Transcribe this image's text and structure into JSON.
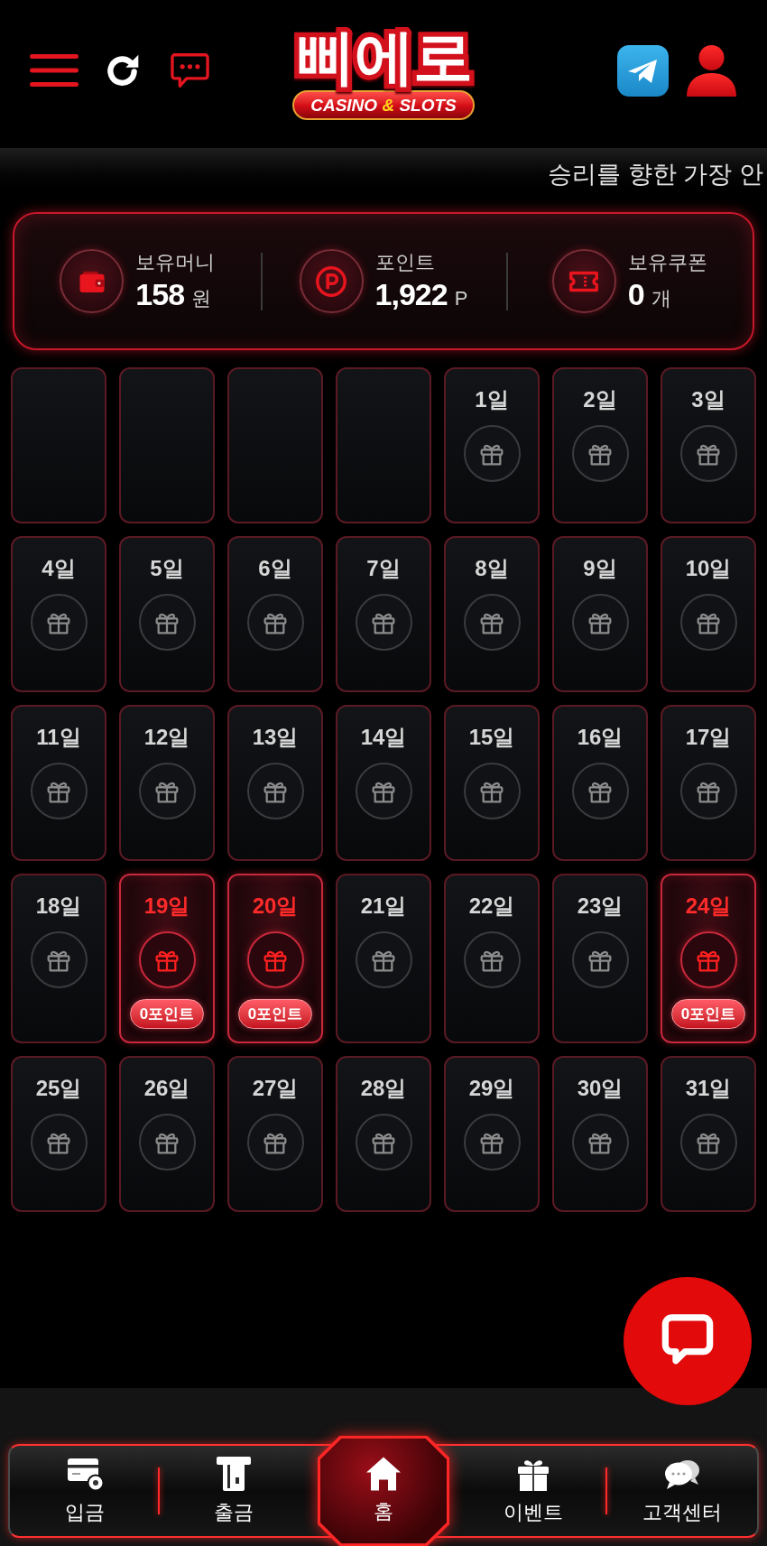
{
  "header": {
    "logo": {
      "title": "삐에로",
      "tagline": [
        {
          "kind": "word",
          "text": "CASINO"
        },
        {
          "kind": "accent",
          "text": "&"
        },
        {
          "kind": "word",
          "text": "SLOTS"
        }
      ]
    }
  },
  "marquee": {
    "text": "승리를 향한 가장 안"
  },
  "summary": [
    {
      "kind": "money",
      "label": "보유머니",
      "value": "158",
      "unit": "원"
    },
    {
      "kind": "points",
      "label": "포인트",
      "value": "1,922",
      "unit": "P"
    },
    {
      "kind": "coupons",
      "label": "보유쿠폰",
      "value": "0",
      "unit": "개"
    }
  ],
  "calendar": {
    "cells": [
      {
        "kind": "empty"
      },
      {
        "kind": "empty"
      },
      {
        "kind": "empty"
      },
      {
        "kind": "empty"
      },
      {
        "kind": "day",
        "label": "1일",
        "attended": false
      },
      {
        "kind": "day",
        "label": "2일",
        "attended": false
      },
      {
        "kind": "day",
        "label": "3일",
        "attended": false
      },
      {
        "kind": "day",
        "label": "4일",
        "attended": false
      },
      {
        "kind": "day",
        "label": "5일",
        "attended": false
      },
      {
        "kind": "day",
        "label": "6일",
        "attended": false
      },
      {
        "kind": "day",
        "label": "7일",
        "attended": false
      },
      {
        "kind": "day",
        "label": "8일",
        "attended": false
      },
      {
        "kind": "day",
        "label": "9일",
        "attended": false
      },
      {
        "kind": "day",
        "label": "10일",
        "attended": false
      },
      {
        "kind": "day",
        "label": "11일",
        "attended": false
      },
      {
        "kind": "day",
        "label": "12일",
        "attended": false
      },
      {
        "kind": "day",
        "label": "13일",
        "attended": false
      },
      {
        "kind": "day",
        "label": "14일",
        "attended": false
      },
      {
        "kind": "day",
        "label": "15일",
        "attended": false
      },
      {
        "kind": "day",
        "label": "16일",
        "attended": false
      },
      {
        "kind": "day",
        "label": "17일",
        "attended": false
      },
      {
        "kind": "day",
        "label": "18일",
        "attended": false
      },
      {
        "kind": "day",
        "label": "19일",
        "attended": true,
        "reward": "0포인트"
      },
      {
        "kind": "day",
        "label": "20일",
        "attended": true,
        "reward": "0포인트"
      },
      {
        "kind": "day",
        "label": "21일",
        "attended": false
      },
      {
        "kind": "day",
        "label": "22일",
        "attended": false
      },
      {
        "kind": "day",
        "label": "23일",
        "attended": false
      },
      {
        "kind": "day",
        "label": "24일",
        "attended": true,
        "reward": "0포인트"
      },
      {
        "kind": "day",
        "label": "25일",
        "attended": false
      },
      {
        "kind": "day",
        "label": "26일",
        "attended": false
      },
      {
        "kind": "day",
        "label": "27일",
        "attended": false
      },
      {
        "kind": "day",
        "label": "28일",
        "attended": false
      },
      {
        "kind": "day",
        "label": "29일",
        "attended": false
      },
      {
        "kind": "day",
        "label": "30일",
        "attended": false
      },
      {
        "kind": "day",
        "label": "31일",
        "attended": false
      }
    ]
  },
  "bottom_nav": [
    {
      "kind": "deposit",
      "label": "입금",
      "selected": false
    },
    {
      "kind": "withdraw",
      "label": "출금",
      "selected": false
    },
    {
      "kind": "home",
      "label": "홈",
      "selected": true
    },
    {
      "kind": "event",
      "label": "이벤트",
      "selected": false
    },
    {
      "kind": "support",
      "label": "고객센터",
      "selected": false
    }
  ]
}
